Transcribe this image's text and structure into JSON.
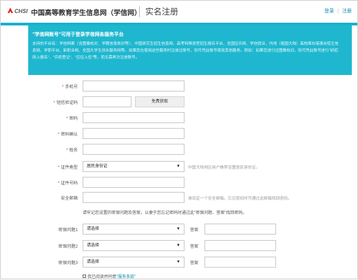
{
  "header": {
    "logo_text": "CHSI",
    "site_name": "中国高等教育学生信息网（学信网）",
    "page_title": "实名注册",
    "links": {
      "login": "登录",
      "separator": "|",
      "register": "注册"
    }
  },
  "notice": {
    "title": "\"学信网账号\"可用于登录学信网各服务平台",
    "body": "支持的平台有：学信档案（含图像校对、学籍信息核对等）、中国研究生招生信息网、高考特殊类型招生报名平台、全国征兵网、学信就业、内地（祖国大陆）高校面向港澳台招生信息网、学职平台、新职业网、全国大学生创业服务网等。如果您在使用这些服务时注册过账号，则可凭此账号使用其他服务。例如：如果您进行过图像校对，则可凭此账号进行\"研招网上报名\"、\"兵役登记\"、\"应征入伍\"等，而无需再次注册账号。"
  },
  "form": {
    "phone": {
      "label": "手机号",
      "value": ""
    },
    "sms_code": {
      "label": "短信验证码",
      "value": "",
      "button": "免费获取"
    },
    "password": {
      "label": "密码",
      "value": ""
    },
    "password_confirm": {
      "label": "密码确认",
      "value": ""
    },
    "name": {
      "label": "姓名",
      "value": ""
    },
    "id_type": {
      "label": "证件类型",
      "selected": "居民身份证",
      "hint": "中国大陆地区用户推荐设置居民身份证。"
    },
    "id_number": {
      "label": "证件号码",
      "value": ""
    },
    "email": {
      "label": "安全邮箱",
      "value": "",
      "hint": "请设定一个安全邮箱，忘记密码时可通过此邮箱找回密码。"
    },
    "security_tip": "请牢记您设置的密保问题及答案，以便于您忘记密码时通过此\"密保问题、答案\"找回密码。",
    "questions": [
      {
        "label": "密保问题1",
        "selected": "请选择",
        "answer_label": "答案",
        "answer": ""
      },
      {
        "label": "密保问题2",
        "selected": "请选择",
        "answer_label": "答案",
        "answer": ""
      },
      {
        "label": "密保问题3",
        "selected": "请选择",
        "answer_label": "答案",
        "answer": ""
      }
    ],
    "agreement": {
      "text": "我已阅读并同意",
      "link": "\"服务条款\""
    }
  },
  "colors": {
    "accent": "#18b1cd",
    "notice_bg": "#1fb7cf",
    "link": "#0e8aa8",
    "required": "#e33333"
  },
  "icons": {
    "logo": "chsi-logo-icon",
    "dropdown": "chevron-down-icon",
    "checkbox": "checkbox-icon"
  }
}
